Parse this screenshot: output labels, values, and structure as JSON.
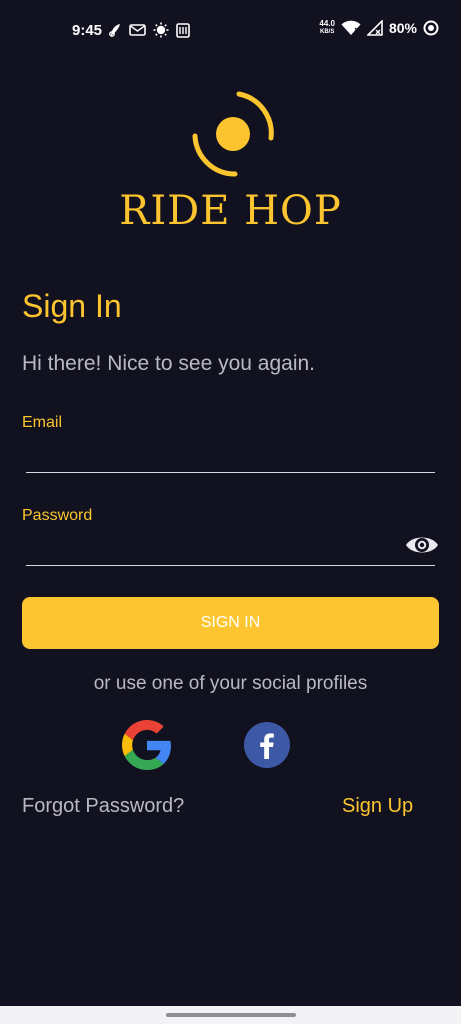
{
  "status_bar": {
    "time": "9:45",
    "net_speed_value": "44.0",
    "net_speed_unit": "KB/S",
    "battery": "80%",
    "icons": [
      "app-notification-icon",
      "mail-icon",
      "sun-icon",
      "news-icon",
      "wifi-icon",
      "signal-icon",
      "battery-ring-icon"
    ]
  },
  "brand": {
    "name": "RIDE HOP",
    "color": "#fcc52f"
  },
  "signin": {
    "title": "Sign In",
    "subtitle": "Hi there! Nice to see you again.",
    "email_label": "Email",
    "email_value": "",
    "password_label": "Password",
    "password_value": "",
    "button_label": "SIGN IN",
    "button_color": "#fdc630"
  },
  "social": {
    "prompt": "or use one of your social profiles",
    "providers": [
      "google-icon",
      "facebook-icon"
    ]
  },
  "links": {
    "forgot_password": "Forgot Password?",
    "sign_up": "Sign Up"
  },
  "colors": {
    "background": "#12111f",
    "muted_text": "#b9b9c6",
    "facebook": "#3d59a5"
  }
}
